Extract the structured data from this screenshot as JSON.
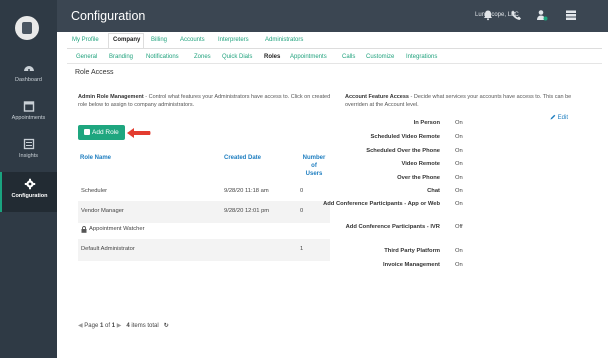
{
  "app": {
    "title": "Configuration",
    "company": "Lunascope, LLC"
  },
  "sidebar": {
    "items": [
      {
        "label": "Dashboard",
        "icon": "gauge-icon"
      },
      {
        "label": "Appointments",
        "icon": "calendar-icon"
      },
      {
        "label": "Insights",
        "icon": "list-icon"
      },
      {
        "label": "Configuration",
        "icon": "gear-icon",
        "active": true
      }
    ]
  },
  "tabs_primary": [
    "My Profile",
    "Company",
    "Billing",
    "Accounts",
    "Interpreters",
    "Administrators"
  ],
  "tabs_secondary": [
    "General",
    "Branding",
    "Notifications",
    "Zones",
    "Quick Dials",
    "Roles",
    "Appointments",
    "Calls",
    "Customize",
    "Integrations"
  ],
  "section": {
    "title": "Role Access"
  },
  "admin_roles": {
    "heading": "Admin Role Management",
    "description": " - Control what features your Administrators have access to. Click on created role below to assign to company administrators.",
    "add_button": "Add Role",
    "columns": {
      "role_name": "Role Name",
      "created_date": "Created Date",
      "num_users_1": "Number",
      "num_users_2": "of",
      "num_users_3": "Users"
    },
    "rows": [
      {
        "name": "Scheduler",
        "date": "9/28/20 11:18 am",
        "users": "0"
      },
      {
        "name": "Vendor Manager",
        "date": "9/28/20 12:01 pm",
        "users": "0"
      },
      {
        "name": "Appointment Watcher",
        "date": "",
        "users": "",
        "locked": true
      },
      {
        "name": "Default Administrator",
        "date": "",
        "users": "1"
      }
    ]
  },
  "account_features": {
    "heading": "Account Feature Access",
    "description": " - Decide what services your accounts have access to. This can be overriden at the Account level.",
    "edit_label": "Edit",
    "features": [
      {
        "label": "In Person",
        "value": "On"
      },
      {
        "label": "Scheduled Video Remote",
        "value": "On"
      },
      {
        "label": "Scheduled Over the Phone",
        "value": "On"
      },
      {
        "label": "Video Remote",
        "value": "On"
      },
      {
        "label": "Over the Phone",
        "value": "On"
      },
      {
        "label": "Chat",
        "value": "On"
      },
      {
        "label": "Add Conference Participants - App or Web",
        "value": "On"
      },
      {
        "label": "Add Conference Participants - IVR",
        "value": "Off"
      },
      {
        "label": "Third Party Platform",
        "value": "On"
      },
      {
        "label": "Invoice Management",
        "value": "On"
      }
    ]
  },
  "pager": {
    "page_word": "Page",
    "current": "1",
    "of_word": "of",
    "total_pages": "1",
    "total_items": "4",
    "items_word": "items total"
  },
  "colors": {
    "accent": "#1ea67f",
    "link": "#1e7ec0",
    "sidebar": "#2f3a45",
    "header": "#3b4652"
  }
}
